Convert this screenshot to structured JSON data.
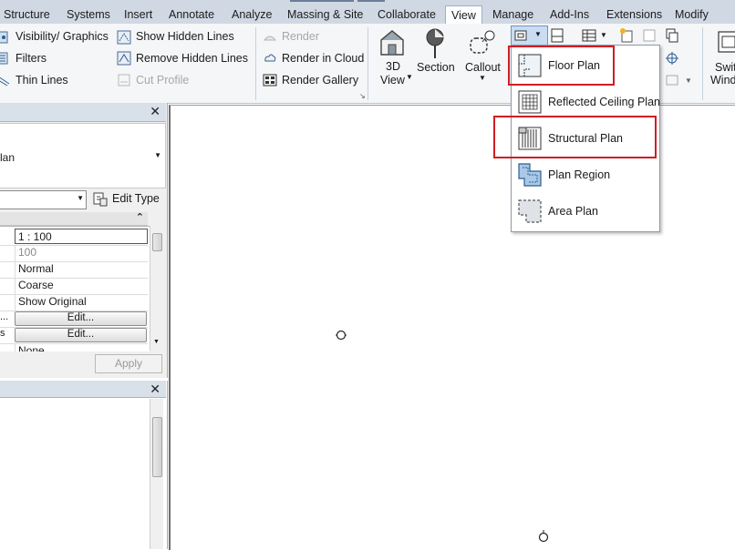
{
  "tabs": [
    "Structure",
    "Systems",
    "Insert",
    "Annotate",
    "Analyze",
    "Massing & Site",
    "Collaborate",
    "View",
    "Manage",
    "Add-Ins",
    "Extensions",
    "Modify"
  ],
  "active_tab": "View",
  "ribbon": {
    "graphics": {
      "visibility": "Visibility/ Graphics",
      "filters": "Filters",
      "thin_lines": "Thin  Lines",
      "show_hidden": "Show  Hidden Lines",
      "remove_hidden": "Remove  Hidden Lines",
      "cut_profile": "Cut  Profile"
    },
    "presentation": {
      "render": "Render",
      "render_cloud": "Render  in Cloud",
      "render_gallery": "Render  Gallery"
    },
    "create": {
      "view3d_line1": "3D",
      "view3d_line2": "View",
      "section": "Section",
      "callout": "Callout"
    },
    "windows": {
      "switch_line1": "Swit",
      "switch_line2": "Wind"
    }
  },
  "properties": {
    "type_partial": "lan",
    "edit_type": "Edit Type",
    "rows": [
      {
        "value": "1 : 100"
      },
      {
        "value": "100"
      },
      {
        "value": "Normal"
      },
      {
        "value": "Coarse"
      },
      {
        "value": "Show Original"
      },
      {
        "label": "...",
        "button": "Edit..."
      },
      {
        "label": "s",
        "button": "Edit..."
      },
      {
        "value": "None"
      }
    ],
    "apply": "Apply"
  },
  "dropdown": {
    "items": [
      "Floor Plan",
      "Reflected Ceiling Plan",
      "Structural Plan",
      "Plan Region",
      "Area Plan"
    ]
  },
  "colors": {
    "highlight": "#d01c24",
    "tabbar": "#cfd8e3",
    "ribbon": "#f4f6f8"
  }
}
